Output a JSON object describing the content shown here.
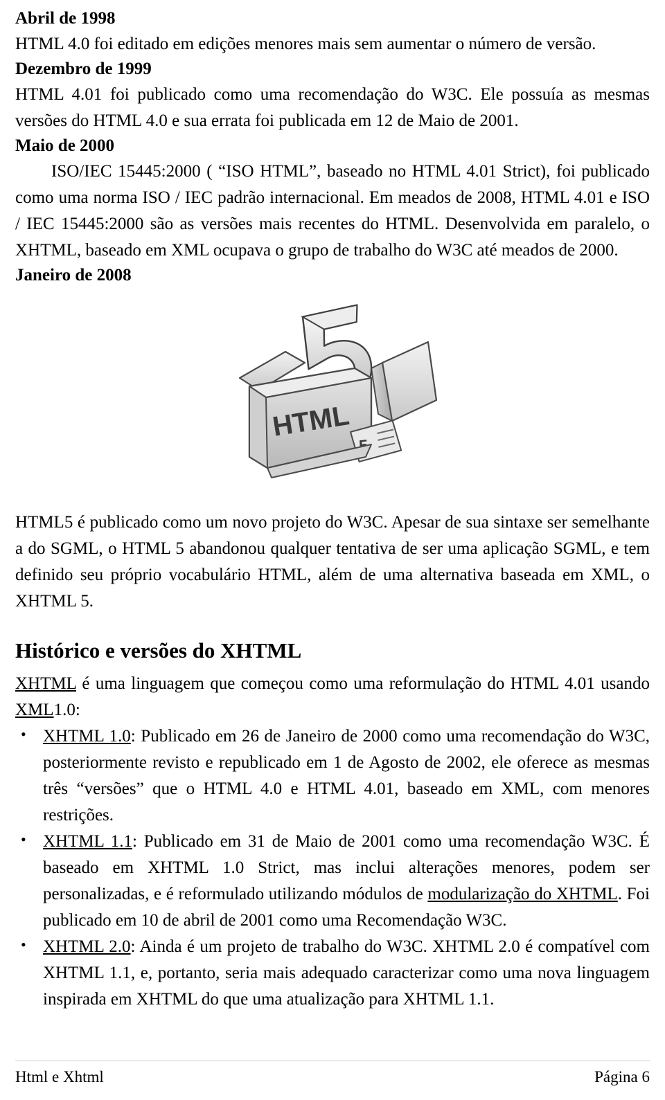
{
  "document": {
    "blocks": [
      {
        "type": "heading",
        "text": "Abril de 1998"
      },
      {
        "type": "paragraph",
        "text": "HTML 4.0 foi editado em edições menores mais sem aumentar o número de versão."
      },
      {
        "type": "heading",
        "text": "Dezembro de 1999"
      },
      {
        "type": "paragraph",
        "text": "HTML 4.01 foi publicado como uma recomendação do W3C. Ele possuía as mesmas versões do HTML 4.0 e sua errata foi publicada em 12 de Maio de 2001."
      },
      {
        "type": "heading",
        "text": "Maio de 2000"
      },
      {
        "type": "paragraph",
        "text": "ISO/IEC 15445:2000 ( “ISO HTML”, baseado no HTML 4.01 Strict), foi publicado como uma norma ISO / IEC padrão internacional. Em meados de 2008, HTML 4.01 e ISO / IEC 15445:2000 são as versões mais recentes do HTML. Desenvolvida em paralelo, o XHTML, baseado em XML ocupava o grupo de trabalho do W3C até meados de 2000."
      },
      {
        "type": "heading",
        "text": "Janeiro de 2008"
      }
    ],
    "figure": {
      "alt": "Caixa de papelão aberta desenhada à mão com o logotipo HTML5",
      "box_label": "HTML",
      "numeral_label": "5",
      "tag_label": "5"
    },
    "after_figure": [
      {
        "type": "paragraph",
        "text": "HTML5 é publicado como um novo projeto do W3C. Apesar de sua sintaxe ser semelhante a do SGML, o HTML 5 abandonou qualquer tentativa de ser uma aplicação SGML, e tem definido seu próprio vocabulário HTML, além de uma alternativa baseada em XML, o XHTML 5."
      }
    ],
    "section": {
      "title": "Histórico e versões do XHTML",
      "intro_parts": [
        {
          "text": "XHTML",
          "underline": true
        },
        {
          "text": " é uma linguagem que começou como uma reformulação do HTML 4.01 usando ",
          "underline": false
        },
        {
          "text": "XML",
          "underline": true
        },
        {
          "text": "1.0:",
          "underline": false
        }
      ],
      "intro_plain": "XHTML é uma linguagem que começou como uma reformulação do HTML 4.01 usando XML1.0:",
      "bullets": [
        {
          "label": "XHTML 1.0",
          "text": ": Publicado em 26 de Janeiro de 2000 como uma recomendação do W3C, posteriormente revisto e republicado em 1 de Agosto de 2002, ele oferece as mesmas três “versões” que o HTML 4.0 e HTML 4.01, baseado em XML, com menores restrições."
        },
        {
          "label": "XHTML 1.1",
          "text": ": Publicado em 31 de Maio de 2001 como uma recomendação W3C. É baseado em XHTML 1.0 Strict, mas inclui alterações menores, podem ser personalizadas, e é reformulado utilizando módulos de modularização do XHTML. Foi publicado em 10 de abril de 2001 como uma Recomendação W3C.",
          "inline_underline": "modularização do XHTML"
        },
        {
          "label": "XHTML 2.0",
          "text": ": Ainda é um projeto de trabalho do W3C. XHTML 2.0 é compatível com XHTML 1.1, e, portanto, seria mais adequado caracterizar como uma nova linguagem inspirada em XHTML do que uma atualização para XHTML 1.1."
        }
      ]
    },
    "footer": {
      "left": "Html e Xhtml",
      "right": "Página 6"
    }
  }
}
